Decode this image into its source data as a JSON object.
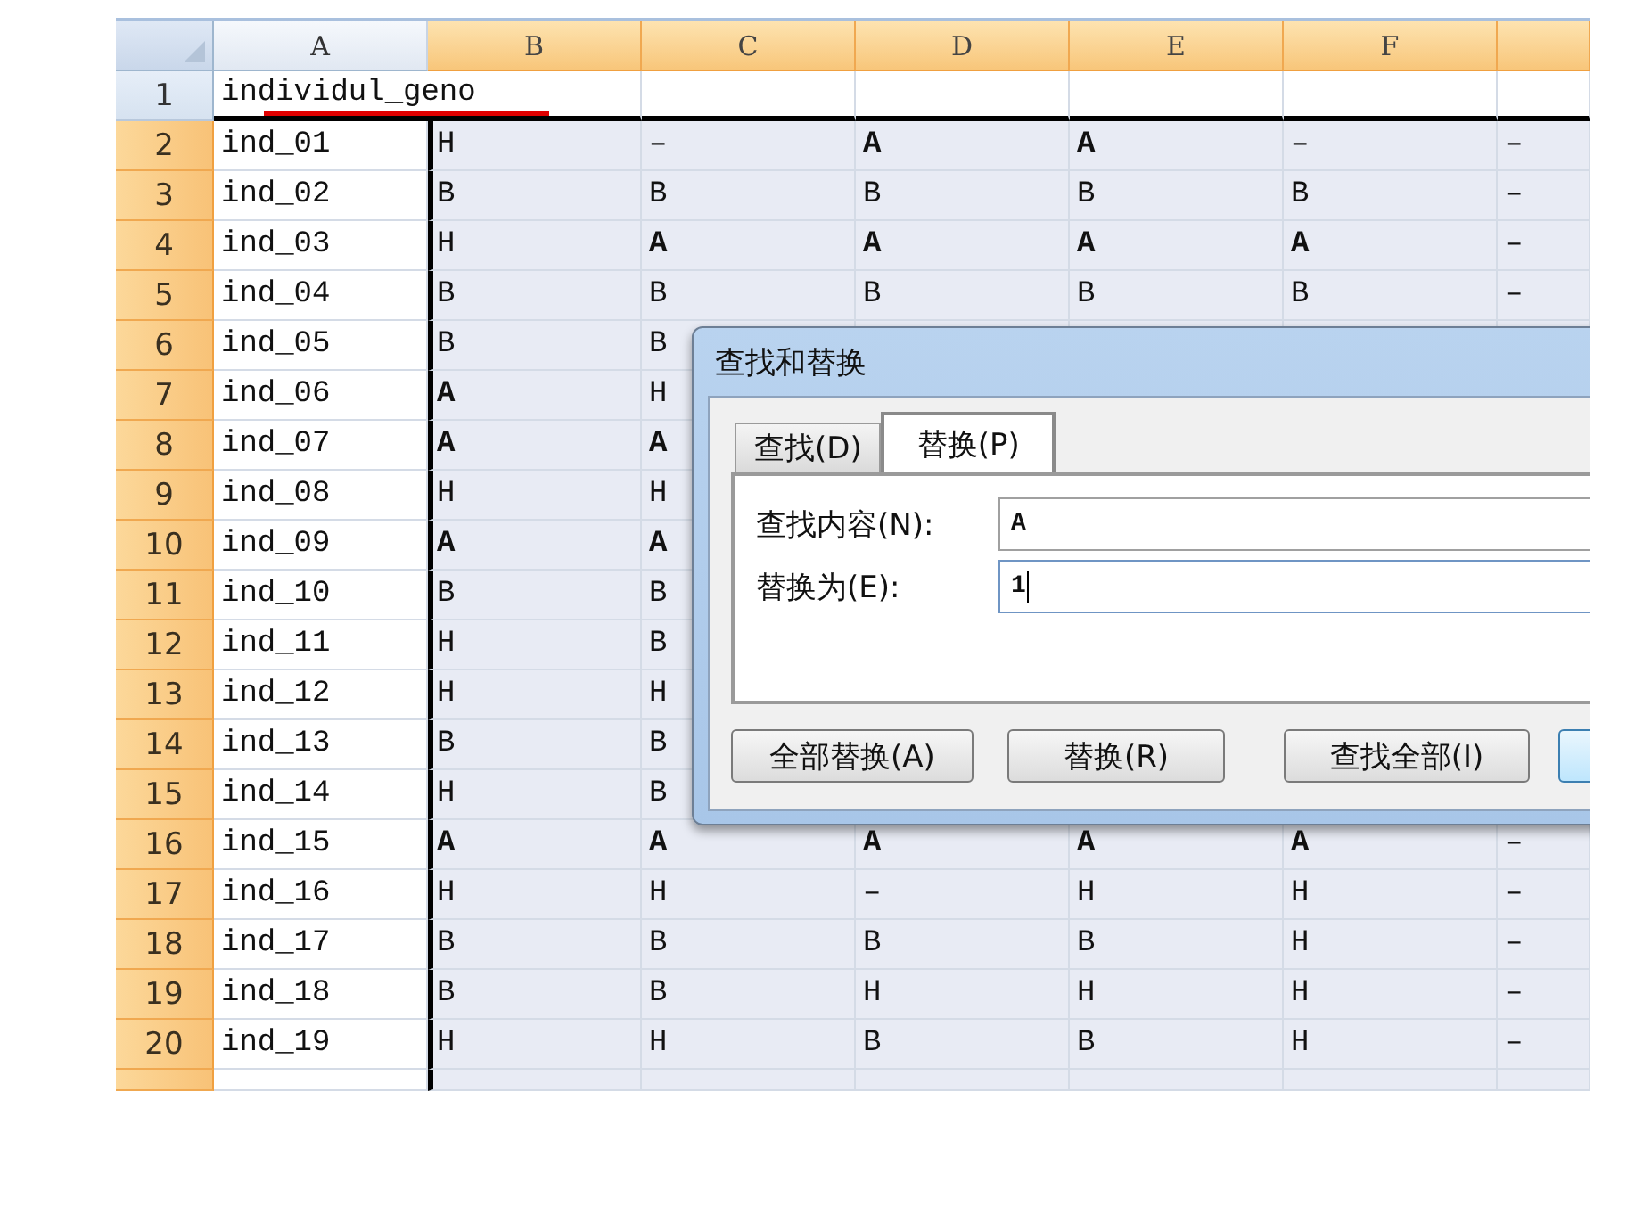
{
  "sheet": {
    "columns": [
      {
        "label": "A",
        "selected": false
      },
      {
        "label": "B",
        "selected": true
      },
      {
        "label": "C",
        "selected": true
      },
      {
        "label": "D",
        "selected": true
      },
      {
        "label": "E",
        "selected": true
      },
      {
        "label": "F",
        "selected": true
      }
    ],
    "rows": [
      {
        "number": "1",
        "selected": false,
        "cells": [
          "individul_geno"
        ]
      },
      {
        "number": "2",
        "selected": true,
        "cells": [
          "ind_01",
          "H",
          "–",
          "A",
          "A",
          "–",
          "–"
        ]
      },
      {
        "number": "3",
        "selected": true,
        "cells": [
          "ind_02",
          "B",
          "B",
          "B",
          "B",
          "B",
          "–"
        ]
      },
      {
        "number": "4",
        "selected": true,
        "cells": [
          "ind_03",
          "H",
          "A",
          "A",
          "A",
          "A",
          "–"
        ]
      },
      {
        "number": "5",
        "selected": true,
        "cells": [
          "ind_04",
          "B",
          "B",
          "B",
          "B",
          "B",
          "–"
        ]
      },
      {
        "number": "6",
        "selected": true,
        "cells": [
          "ind_05",
          "B",
          "B"
        ]
      },
      {
        "number": "7",
        "selected": true,
        "cells": [
          "ind_06",
          "A",
          "H"
        ]
      },
      {
        "number": "8",
        "selected": true,
        "cells": [
          "ind_07",
          "A",
          "A"
        ]
      },
      {
        "number": "9",
        "selected": true,
        "cells": [
          "ind_08",
          "H",
          "H"
        ]
      },
      {
        "number": "10",
        "selected": true,
        "cells": [
          "ind_09",
          "A",
          "A"
        ]
      },
      {
        "number": "11",
        "selected": true,
        "cells": [
          "ind_10",
          "B",
          "B"
        ]
      },
      {
        "number": "12",
        "selected": true,
        "cells": [
          "ind_11",
          "H",
          "B"
        ]
      },
      {
        "number": "13",
        "selected": true,
        "cells": [
          "ind_12",
          "H",
          "H"
        ]
      },
      {
        "number": "14",
        "selected": true,
        "cells": [
          "ind_13",
          "B",
          "B"
        ]
      },
      {
        "number": "15",
        "selected": true,
        "cells": [
          "ind_14",
          "H",
          "B"
        ]
      },
      {
        "number": "16",
        "selected": true,
        "cells": [
          "ind_15",
          "A",
          "A",
          "A",
          "A",
          "A",
          "–"
        ]
      },
      {
        "number": "17",
        "selected": true,
        "cells": [
          "ind_16",
          "H",
          "H",
          "–",
          "H",
          "H",
          "–"
        ]
      },
      {
        "number": "18",
        "selected": true,
        "cells": [
          "ind_17",
          "B",
          "B",
          "B",
          "B",
          "H",
          "–"
        ]
      },
      {
        "number": "19",
        "selected": true,
        "cells": [
          "ind_18",
          "B",
          "B",
          "H",
          "H",
          "H",
          "–"
        ]
      },
      {
        "number": "20",
        "selected": true,
        "cells": [
          "ind_19",
          "H",
          "H",
          "B",
          "B",
          "H",
          "–"
        ]
      }
    ]
  },
  "dialog": {
    "title": "查找和替换",
    "tabs": [
      {
        "label": "查找(D)",
        "selected": false
      },
      {
        "label": "替换(P)",
        "selected": true
      }
    ],
    "fields": [
      {
        "label": "查找内容(N):",
        "value": "A",
        "focused": false
      },
      {
        "label": "替换为(E):",
        "value": "1",
        "focused": true
      }
    ],
    "buttons": [
      "全部替换(A)",
      "替换(R)",
      "查找全部(I)"
    ]
  }
}
